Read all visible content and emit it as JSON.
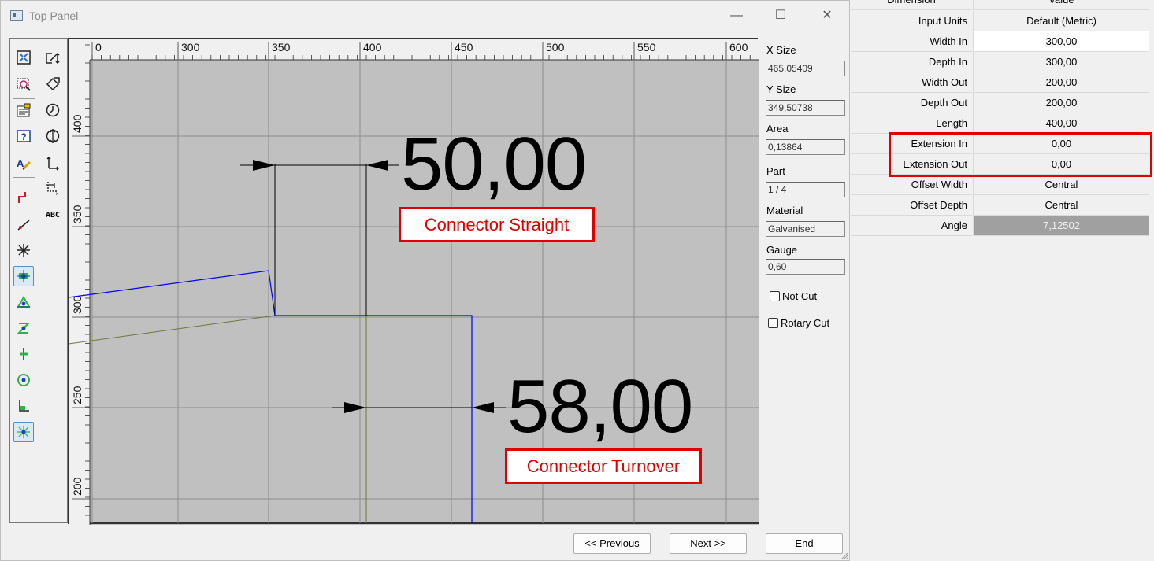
{
  "window": {
    "title": "Top Panel",
    "minimize_glyph": "—",
    "maximize_glyph": "☐",
    "close_glyph": "✕"
  },
  "toolbar": {
    "left_icons": [
      "zoom-fit-icon",
      "zoom-window-icon",
      "properties-icon",
      "help-icon",
      "text-edit-icon",
      "step-line-icon",
      "line-tool-icon",
      "snap-star-icon",
      "snap-point-icon",
      "snap-triangle-icon",
      "snap-cross-icon",
      "snap-plus-icon",
      "snap-circle-icon",
      "snap-corner-icon",
      "snap-all-icon"
    ],
    "right_icons": [
      "move-icon",
      "rotate-icon",
      "timer-icon",
      "mirror-icon",
      "axis-icon",
      "dimension-icon"
    ],
    "abc_label": "ABC"
  },
  "ruler": {
    "x_labels": [
      "0",
      "300",
      "350",
      "400",
      "450",
      "500",
      "550",
      "600"
    ],
    "y_labels": [
      "400",
      "350",
      "300",
      "250",
      "200"
    ]
  },
  "dimensions": {
    "top_value": "50,00",
    "bottom_value": "58,00"
  },
  "annotations": {
    "straight": "Connector Straight",
    "turnover": "Connector Turnover"
  },
  "side_fields": [
    {
      "label": "X Size",
      "value": "465,05409"
    },
    {
      "label": "Y Size",
      "value": "349,50738"
    },
    {
      "label": "Area",
      "value": "0,13864"
    },
    {
      "label": "Part",
      "value": "1 / 4"
    },
    {
      "label": "Material",
      "value": "Galvanised"
    },
    {
      "label": "Gauge",
      "value": "0,60"
    }
  ],
  "checkboxes": {
    "not_cut": "Not Cut",
    "rotary_cut": "Rotary Cut"
  },
  "buttons": {
    "previous": "<< Previous",
    "next": "Next >>",
    "end": "End"
  },
  "property_grid": {
    "header_name": "Dimension",
    "header_value": "Value",
    "rows": [
      {
        "name": "Input Units",
        "value": "Default (Metric)"
      },
      {
        "name": "Width In",
        "value": "300,00"
      },
      {
        "name": "Depth In",
        "value": "300,00"
      },
      {
        "name": "Width Out",
        "value": "200,00"
      },
      {
        "name": "Depth Out",
        "value": "200,00"
      },
      {
        "name": "Length",
        "value": "400,00"
      },
      {
        "name": "Extension In",
        "value": "0,00"
      },
      {
        "name": "Extension Out",
        "value": "0,00"
      },
      {
        "name": "Offset Width",
        "value": "Central"
      },
      {
        "name": "Offset Depth",
        "value": "Central"
      },
      {
        "name": "Angle",
        "value": "7,12502"
      }
    ]
  },
  "colors": {
    "highlight": "#e00000",
    "cad_background": "#c0c0c0",
    "shape_blue": "#0000ff",
    "shape_olive": "#6b7a3a"
  }
}
